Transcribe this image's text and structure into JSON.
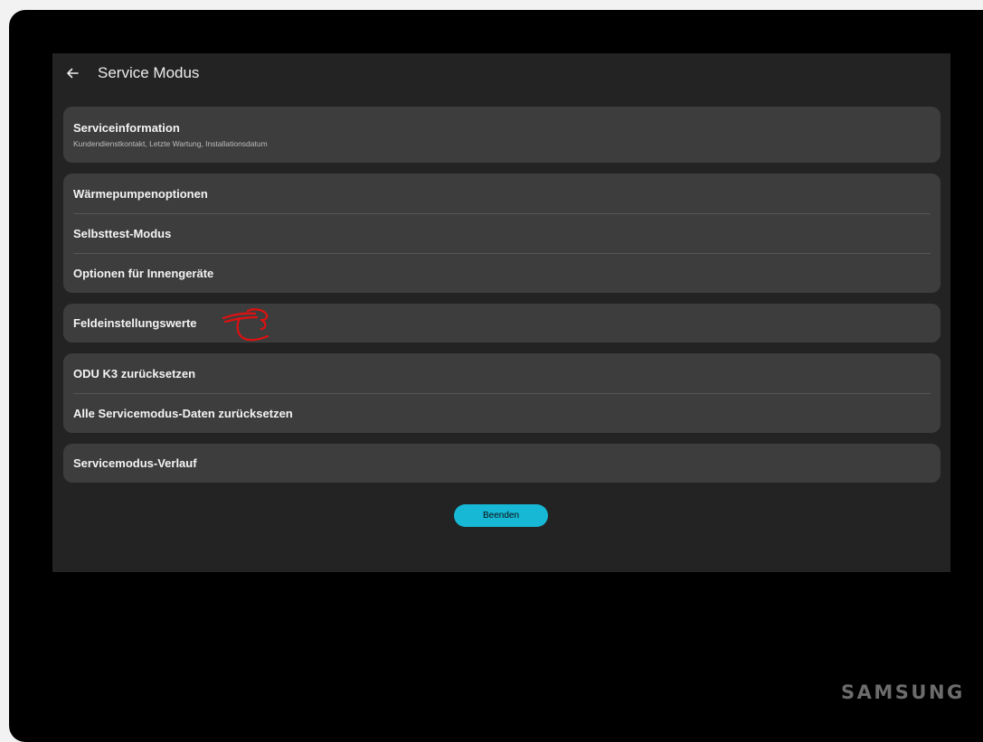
{
  "header": {
    "title": "Service Modus",
    "back_icon": "arrow-left-icon"
  },
  "groups": [
    {
      "rows": [
        {
          "label": "Serviceinformation",
          "subtitle": "Kundendienstkontakt, Letzte Wartung, Installationsdatum"
        }
      ]
    },
    {
      "rows": [
        {
          "label": "Wärmepumpenoptionen"
        },
        {
          "label": "Selbsttest-Modus"
        },
        {
          "label": "Optionen für Innengeräte"
        }
      ]
    },
    {
      "rows": [
        {
          "label": "Feldeinstellungswerte"
        }
      ]
    },
    {
      "rows": [
        {
          "label": "ODU K3 zurücksetzen"
        },
        {
          "label": "Alle Servicemodus-Daten zurücksetzen"
        }
      ]
    },
    {
      "rows": [
        {
          "label": "Servicemodus-Verlauf"
        }
      ]
    }
  ],
  "end_button": {
    "label": "Beenden"
  },
  "brand": "SAMSUNG",
  "annotation": {
    "icon": "red-pointing-hand-scribble-icon",
    "color": "#e01010"
  },
  "colors": {
    "accent": "#16b8d6",
    "screen_background": "#232323",
    "card_background": "#3d3d3d",
    "bezel": "#000000"
  }
}
